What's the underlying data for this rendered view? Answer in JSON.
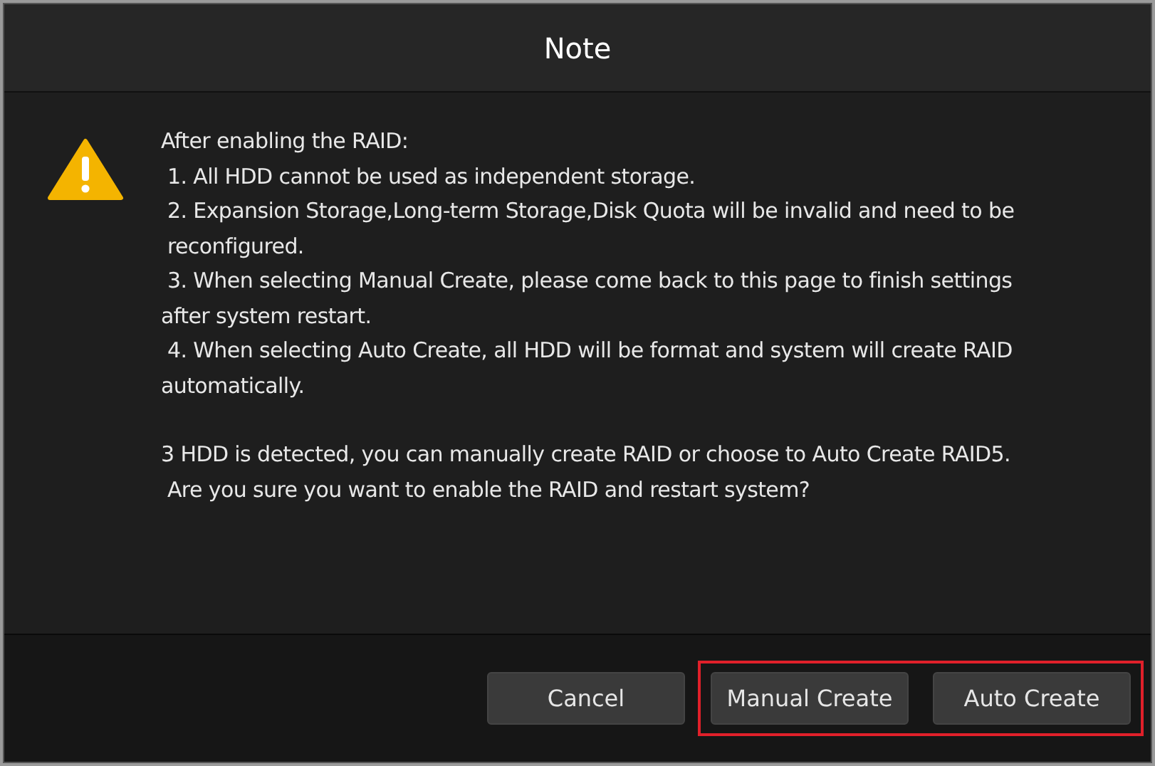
{
  "dialog": {
    "title": "Note"
  },
  "message": [
    {
      "lines": [
        "After enabling the RAID:",
        " 1. All HDD cannot be used as independent storage.",
        " 2. Expansion Storage,Long-term Storage,Disk Quota will be invalid and need to be",
        " reconfigured.",
        " 3. When selecting Manual Create, please come back to this page to finish settings",
        "after system restart.",
        " 4. When selecting Auto Create, all HDD will be format and system will create RAID",
        "automatically."
      ]
    },
    {
      "lines": [
        "3 HDD is detected, you can manually create RAID or choose to Auto Create RAID5.",
        " Are you sure you want to enable the RAID and restart system?"
      ]
    }
  ],
  "button_groups": [
    {
      "highlighted": false,
      "buttons": [
        "Cancel"
      ]
    },
    {
      "highlighted": true,
      "buttons": [
        "Manual Create",
        "Auto Create"
      ]
    }
  ]
}
